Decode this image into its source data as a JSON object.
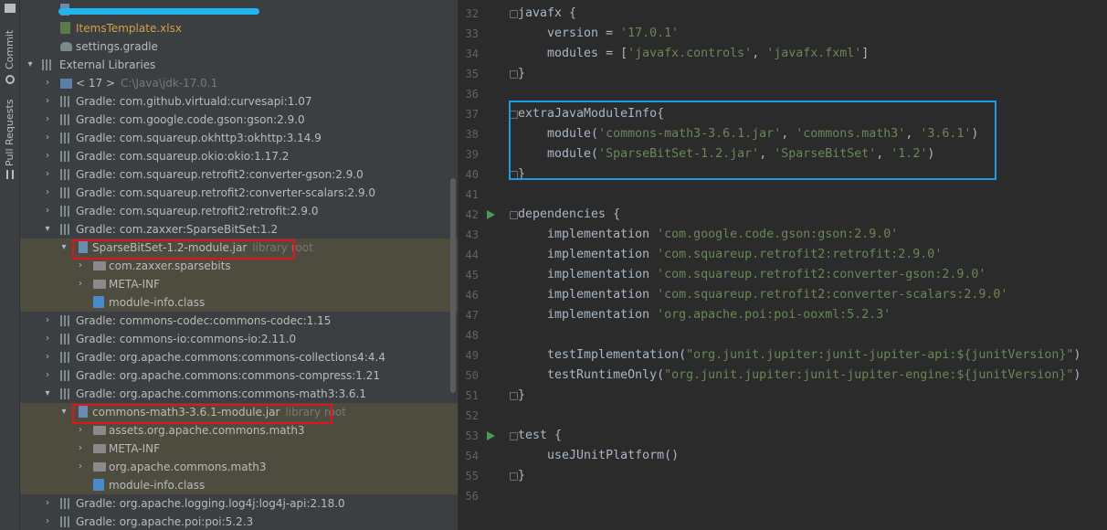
{
  "tool_strip": {
    "commit_label": "Commit",
    "pull_requests_label": "Pull Requests"
  },
  "tree": {
    "rows": [
      {
        "text": "",
        "hint": ""
      },
      {
        "text": "ItemsTemplate.xlsx",
        "hint": ""
      },
      {
        "text": "settings.gradle",
        "hint": ""
      },
      {
        "text": "External Libraries",
        "hint": ""
      },
      {
        "text": "< 17 >",
        "hint": "C:\\Java\\jdk-17.0.1"
      },
      {
        "text": "Gradle: com.github.virtuald:curvesapi:1.07",
        "hint": ""
      },
      {
        "text": "Gradle: com.google.code.gson:gson:2.9.0",
        "hint": ""
      },
      {
        "text": "Gradle: com.squareup.okhttp3:okhttp:3.14.9",
        "hint": ""
      },
      {
        "text": "Gradle: com.squareup.okio:okio:1.17.2",
        "hint": ""
      },
      {
        "text": "Gradle: com.squareup.retrofit2:converter-gson:2.9.0",
        "hint": ""
      },
      {
        "text": "Gradle: com.squareup.retrofit2:converter-scalars:2.9.0",
        "hint": ""
      },
      {
        "text": "Gradle: com.squareup.retrofit2:retrofit:2.9.0",
        "hint": ""
      },
      {
        "text": "Gradle: com.zaxxer:SparseBitSet:1.2",
        "hint": ""
      },
      {
        "text": "SparseBitSet-1.2-module.jar",
        "hint": "library root"
      },
      {
        "text": "com.zaxxer.sparsebits",
        "hint": ""
      },
      {
        "text": "META-INF",
        "hint": ""
      },
      {
        "text": "module-info.class",
        "hint": ""
      },
      {
        "text": "Gradle: commons-codec:commons-codec:1.15",
        "hint": ""
      },
      {
        "text": "Gradle: commons-io:commons-io:2.11.0",
        "hint": ""
      },
      {
        "text": "Gradle: org.apache.commons:commons-collections4:4.4",
        "hint": ""
      },
      {
        "text": "Gradle: org.apache.commons:commons-compress:1.21",
        "hint": ""
      },
      {
        "text": "Gradle: org.apache.commons:commons-math3:3.6.1",
        "hint": ""
      },
      {
        "text": "commons-math3-3.6.1-module.jar",
        "hint": "library root"
      },
      {
        "text": "assets.org.apache.commons.math3",
        "hint": ""
      },
      {
        "text": "META-INF",
        "hint": ""
      },
      {
        "text": "org.apache.commons.math3",
        "hint": ""
      },
      {
        "text": "module-info.class",
        "hint": ""
      },
      {
        "text": "Gradle: org.apache.logging.log4j:log4j-api:2.18.0",
        "hint": ""
      },
      {
        "text": "Gradle: org.apache.poi:poi:5.2.3",
        "hint": ""
      }
    ]
  },
  "editor": {
    "lines": [
      {
        "n": "32",
        "code": "javafx {"
      },
      {
        "n": "33",
        "code": "    version = '17.0.1'"
      },
      {
        "n": "34",
        "code": "    modules = ['javafx.controls', 'javafx.fxml']"
      },
      {
        "n": "35",
        "code": "}"
      },
      {
        "n": "36",
        "code": ""
      },
      {
        "n": "37",
        "code": "extraJavaModuleInfo{"
      },
      {
        "n": "38",
        "code": "    module('commons-math3-3.6.1.jar', 'commons.math3', '3.6.1')"
      },
      {
        "n": "39",
        "code": "    module('SparseBitSet-1.2.jar', 'SparseBitSet', '1.2')"
      },
      {
        "n": "40",
        "code": "}"
      },
      {
        "n": "41",
        "code": ""
      },
      {
        "n": "42",
        "code": "dependencies {"
      },
      {
        "n": "43",
        "code": "    implementation 'com.google.code.gson:gson:2.9.0'"
      },
      {
        "n": "44",
        "code": "    implementation 'com.squareup.retrofit2:retrofit:2.9.0'"
      },
      {
        "n": "45",
        "code": "    implementation 'com.squareup.retrofit2:converter-gson:2.9.0'"
      },
      {
        "n": "46",
        "code": "    implementation 'com.squareup.retrofit2:converter-scalars:2.9.0'"
      },
      {
        "n": "47",
        "code": "    implementation 'org.apache.poi:poi-ooxml:5.2.3'"
      },
      {
        "n": "48",
        "code": ""
      },
      {
        "n": "49",
        "code": "    testImplementation(\"org.junit.jupiter:junit-jupiter-api:${junitVersion}\")"
      },
      {
        "n": "50",
        "code": "    testRuntimeOnly(\"org.junit.jupiter:junit-jupiter-engine:${junitVersion}\")"
      },
      {
        "n": "51",
        "code": "}"
      },
      {
        "n": "52",
        "code": ""
      },
      {
        "n": "53",
        "code": "test {"
      },
      {
        "n": "54",
        "code": "    useJUnitPlatform()"
      },
      {
        "n": "55",
        "code": "}"
      },
      {
        "n": "56",
        "code": ""
      }
    ]
  },
  "colors": {
    "highlight_red": "#e0141e",
    "highlight_blue": "#1e9be0",
    "string_green": "#6a8759",
    "run_green": "#499c54"
  }
}
